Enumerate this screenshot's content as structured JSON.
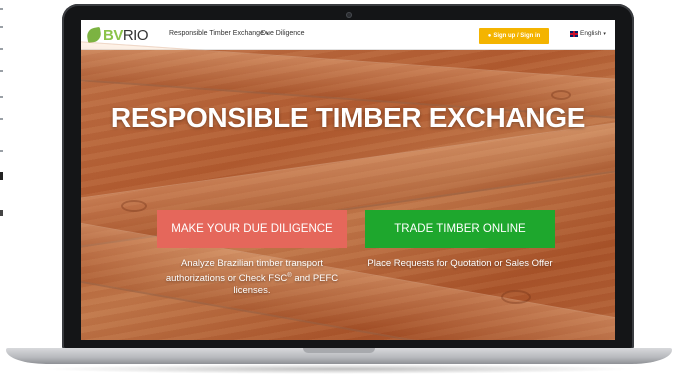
{
  "nav": {
    "logo": {
      "prefix": "BV",
      "suffix": "RIO"
    },
    "links": [
      {
        "label": "Responsible Timber Exchange",
        "caret": "▾"
      },
      {
        "label": "Due Diligence"
      }
    ],
    "signin_label": "Sign up / Sign in",
    "language": {
      "label": "English",
      "caret": "▾"
    }
  },
  "hero": {
    "title": "RESPONSIBLE TIMBER EXCHANGE",
    "cta_due_diligence": "MAKE YOUR DUE DILIGENCE",
    "cta_trade": "TRADE TIMBER ONLINE",
    "desc_due_diligence_a": "Analyze Brazilian timber transport authorizations or Check FSC",
    "desc_due_diligence_reg": "®",
    "desc_due_diligence_b": " and PEFC licenses.",
    "desc_trade": "Place Requests for Quotation or Sales Offer"
  },
  "colors": {
    "brand_green": "#8bc34a",
    "signin_yellow": "#f4b400",
    "due_diligence_red": "#e5675b",
    "trade_green": "#1ea72d"
  },
  "icons": [
    "leaf-logo-icon",
    "user-icon",
    "uk-flag-icon",
    "caret-down-icon"
  ]
}
